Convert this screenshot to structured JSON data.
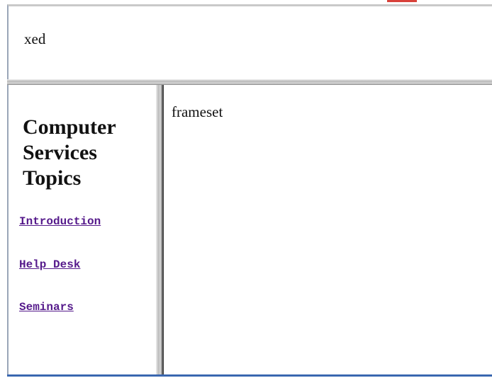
{
  "top_frame": {
    "text": "xed"
  },
  "left_frame": {
    "heading": "Computer Services Topics",
    "links": [
      {
        "label": "Introduction"
      },
      {
        "label": "Help Desk"
      },
      {
        "label": "Seminars"
      }
    ]
  },
  "right_frame": {
    "text": "frameset"
  },
  "colors": {
    "link_visited": "#551a8b",
    "frame_divider": "#bdbdbd",
    "bottom_border": "#3a67b0"
  }
}
